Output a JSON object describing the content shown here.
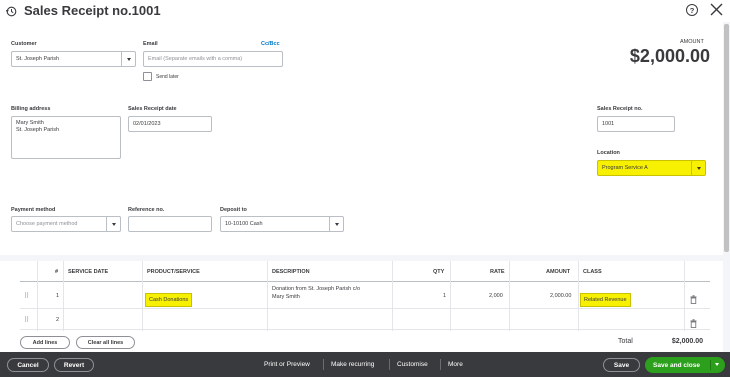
{
  "header": {
    "title": "Sales Receipt no.1001"
  },
  "customer": {
    "label": "Customer",
    "value": "St. Joseph Parish"
  },
  "email": {
    "label": "Email",
    "cc_bcc": "Cc/Bcc",
    "placeholder": "Email (Separate emails with a comma)",
    "send_later": "Send later"
  },
  "amount": {
    "label": "AMOUNT",
    "value": "$2,000.00"
  },
  "billing": {
    "label": "Billing address",
    "line1": "Mary Smith",
    "line2": "St. Joseph Parish"
  },
  "receipt_date": {
    "label": "Sales Receipt date",
    "value": "02/01/2023"
  },
  "receipt_no": {
    "label": "Sales Receipt no.",
    "value": "1001"
  },
  "location": {
    "label": "Location",
    "value": "Program Service A"
  },
  "payment_method": {
    "label": "Payment method",
    "placeholder": "Choose payment method"
  },
  "reference": {
    "label": "Reference no.",
    "value": ""
  },
  "deposit_to": {
    "label": "Deposit to",
    "value": "10-10100 Cash"
  },
  "table": {
    "headers": {
      "num": "#",
      "service_date": "SERVICE DATE",
      "product": "PRODUCT/SERVICE",
      "description": "DESCRIPTION",
      "qty": "QTY",
      "rate": "RATE",
      "amount": "AMOUNT",
      "class": "CLASS"
    },
    "rows": [
      {
        "num": "1",
        "service_date": "",
        "product": "Cash Donations",
        "description_line1": "Donation from St. Joseph Parish c/o",
        "description_line2": "Mary Smith",
        "qty": "1",
        "rate": "2,000",
        "amount": "2,000.00",
        "class": "Related Revenue"
      },
      {
        "num": "2",
        "service_date": "",
        "product": "",
        "description_line1": "",
        "description_line2": "",
        "qty": "",
        "rate": "",
        "amount": "",
        "class": ""
      }
    ]
  },
  "table_actions": {
    "add_lines": "Add lines",
    "clear_all": "Clear all lines"
  },
  "total": {
    "label": "Total",
    "value": "$2,000.00"
  },
  "footer": {
    "cancel": "Cancel",
    "revert": "Revert",
    "print_preview": "Print or Preview",
    "make_recurring": "Make recurring",
    "customise": "Customise",
    "more": "More",
    "save": "Save",
    "save_close": "Save and close"
  },
  "colors": {
    "highlight": "#f7f000",
    "primary_green": "#2ca01c",
    "footer_bg": "#393a3d",
    "link": "#0077c5"
  }
}
